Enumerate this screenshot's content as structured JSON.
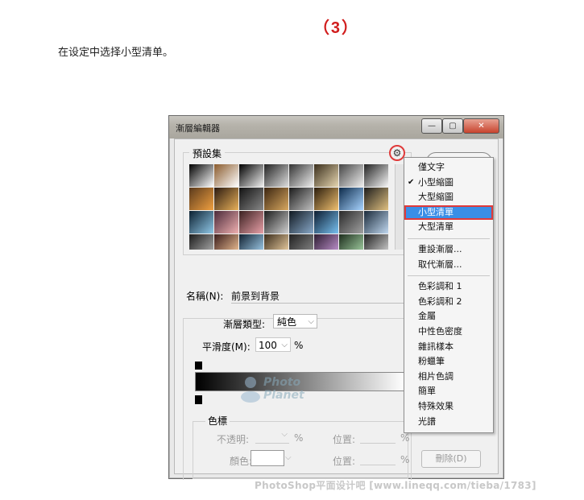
{
  "step": "（3）",
  "instruction": "在设定中选择小型清单。",
  "window": {
    "title": "漸層編輯器",
    "controls": {
      "minimize": "—",
      "maximize": "▢",
      "close": "✕"
    }
  },
  "presets": {
    "label": "預設集",
    "swatches": [
      [
        "#000",
        "#fff"
      ],
      [
        "#8a5a2c",
        "#fff"
      ],
      [
        "#000",
        "#fff0"
      ],
      [
        "#222",
        "#ddd"
      ],
      [
        "#333",
        "#eee"
      ],
      [
        "#3a2e1c",
        "#e6d6b0"
      ],
      [
        "#444",
        "#eee"
      ],
      [
        "#222",
        "#f6f6f6"
      ],
      [
        "#5a3a1c",
        "#f0a040"
      ],
      [
        "#2b1a10",
        "#e8b05a"
      ],
      [
        "#111",
        "#888"
      ],
      [
        "#3a2410",
        "#d8a860"
      ],
      [
        "#1a1a1a",
        "#c0c0c0"
      ],
      [
        "#2a1c0c",
        "#f0c070"
      ],
      [
        "#0c2a4a",
        "#a8d4ff"
      ],
      [
        "#1c1c1c",
        "#e0c080"
      ],
      [
        "#0c2030",
        "#90c8e8"
      ],
      [
        "#4a2a3a",
        "#f0b0b0"
      ],
      [
        "#3a2020",
        "#e8a0a8"
      ],
      [
        "#1c1c1c",
        "#cfcfcf"
      ],
      [
        "#101820",
        "#88a8c8"
      ],
      [
        "#0c1c30",
        "#78c0f0"
      ],
      [
        "#2a2a2a",
        "#a0a0a0"
      ],
      [
        "#1a2a3a",
        "#c0d8f0"
      ],
      [
        "#1a1a1a",
        "#bbbbbb"
      ],
      [
        "#3a1c1c",
        "#ffd0a0"
      ],
      [
        "#102030",
        "#b0e0ff"
      ],
      [
        "#3a2c1c",
        "#ffe0b0"
      ],
      [
        "#202020",
        "#909090"
      ],
      [
        "#2c1c30",
        "#d0a0e0"
      ],
      [
        "#1c2c1c",
        "#b0e0b0"
      ],
      [
        "#202020",
        "#e0e0e0"
      ]
    ]
  },
  "name": {
    "label": "名稱(N):",
    "value": "前景到背景"
  },
  "gradient_type": {
    "label": "漸層類型:",
    "value": "純色"
  },
  "smoothness": {
    "label": "平滑度(M):",
    "value": "100",
    "unit": "%"
  },
  "color_stops": {
    "label": "色標",
    "opacity_label": "不透明:",
    "opacity_unit": "%",
    "location_label": "位置:",
    "location_unit": "%",
    "color_label": "顏色:",
    "delete_label": "刪除(D)"
  },
  "logo": {
    "line1": "Photo",
    "line2": "Planet"
  },
  "menu": {
    "items_group1": [
      "僅文字",
      "小型縮圖",
      "大型縮圖",
      "小型清單",
      "大型清單"
    ],
    "checked": "✔",
    "items_group2": [
      "重設漸層...",
      "取代漸層..."
    ],
    "items_group3": [
      "色彩調和 1",
      "色彩調和 2",
      "金屬",
      "中性色密度",
      "雜訊樣本",
      "粉蠟筆",
      "相片色調",
      "簡單",
      "特殊效果",
      "光譜"
    ]
  },
  "footer": "PhotoShop平面设计吧 [www.lineqq.com/tieba/1783]",
  "colors": {
    "accent_red": "#e03a3a",
    "highlight_blue": "#3a8ee6",
    "step_red": "#d11d1d"
  }
}
